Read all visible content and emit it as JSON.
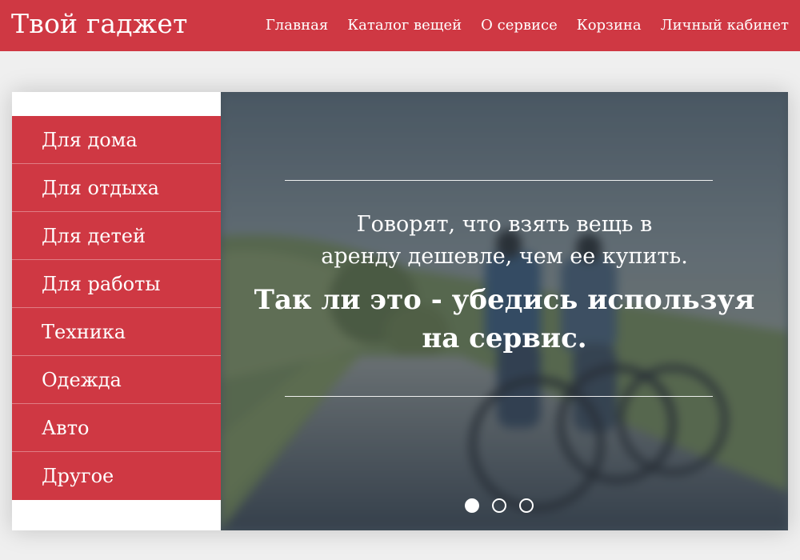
{
  "header": {
    "brand": "Твой гаджет",
    "nav": [
      "Главная",
      "Каталог вещей",
      "О сервисе",
      "Корзина",
      "Личный кабинет"
    ]
  },
  "sidebar": {
    "items": [
      "Для дома",
      "Для отдыха",
      "Для детей",
      "Для работы",
      "Техника",
      "Одежда",
      "Авто",
      "Другое"
    ]
  },
  "hero": {
    "quote_line1": "Говорят, что взять вещь в",
    "quote_line2": "аренду дешевле, чем ее купить.",
    "bold_line1": "Так ли это - убедись используя",
    "bold_line2": "на сервис.",
    "slides_total": 3,
    "active_slide": 1
  },
  "colors": {
    "accent": "#cf3843",
    "page_background": "#efefef"
  }
}
